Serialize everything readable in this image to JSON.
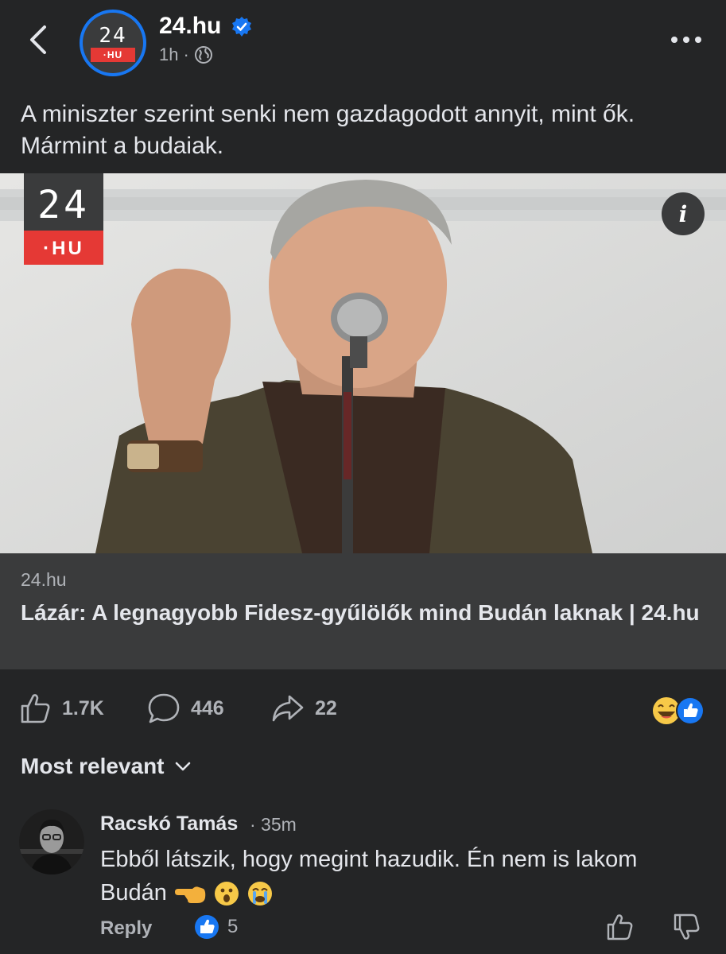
{
  "header": {
    "page_name": "24.hu",
    "time": "1h",
    "separator": "·",
    "avatar_text_top": "24",
    "avatar_text_bottom": "·HU"
  },
  "post": {
    "text": "A miniszter szerint senki nem gazdagodott annyit, mint ők. Mármint a budaiak.",
    "image_logo_top": "24",
    "image_logo_bottom": "·HU"
  },
  "link": {
    "domain": "24.hu",
    "title": "Lázár: A legnagyobb Fidesz-gyűlölők mind Budán laknak | 24.hu"
  },
  "actions": {
    "likes": "1.7K",
    "comments": "446",
    "shares": "22"
  },
  "sort": {
    "label": "Most relevant"
  },
  "comment": {
    "author": "Racskó Tamás",
    "time": "· 35m",
    "text": "Ebből látszik, hogy megint hazudik. Én nem is lakom Budán",
    "reply_label": "Reply",
    "like_count": "5"
  },
  "colors": {
    "background": "#242526",
    "link_box": "#3a3b3c",
    "accent_blue": "#1877f2",
    "brand_red": "#e53935"
  }
}
